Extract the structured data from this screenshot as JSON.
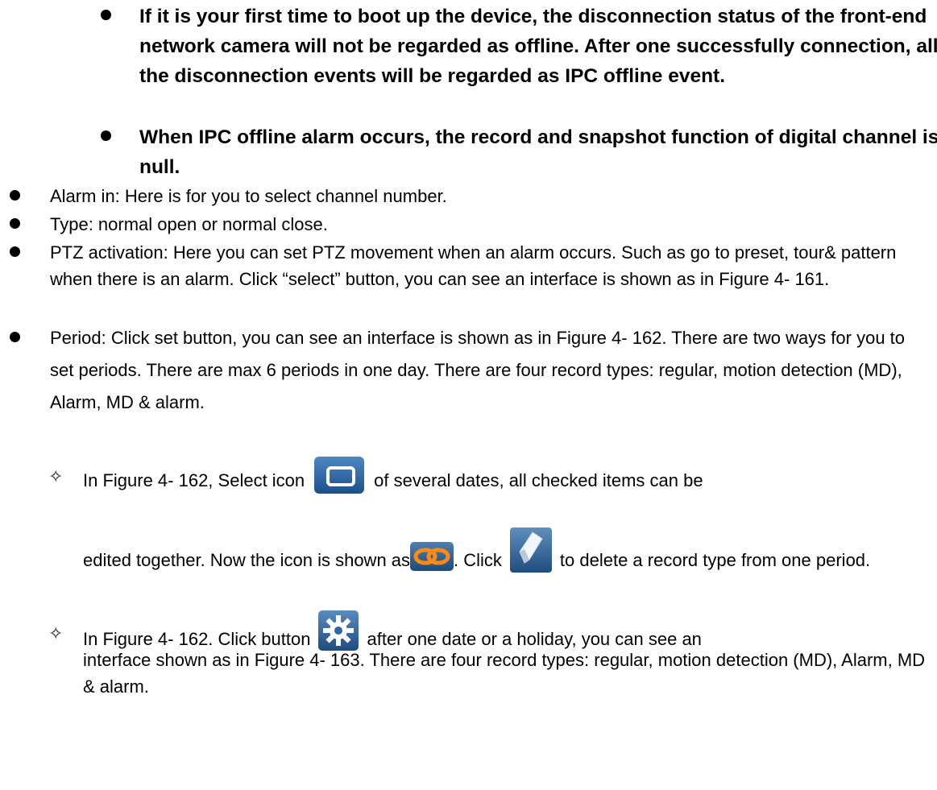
{
  "notes": [
    "If it is your first time to boot up the device, the disconnection status of the front-end network camera will not be regarded as offline. After one successfully connection, all the disconnection events will be regarded as IPC offline event.",
    "When IPC offline alarm occurs, the record and snapshot function of digital channel is null."
  ],
  "bullets": {
    "alarm_in": "Alarm in: Here is for you to select channel number.",
    "type": "Type: normal open or normal close.",
    "ptz": "PTZ activation: Here you can set PTZ movement when an alarm occurs. Such as go to preset, tour& pattern when there is an alarm. Click “select” button, you can see an interface is shown as in Figure 4- 161.",
    "period": "Period: Click set button, you can see an interface is shown as in Figure 4- 162. There are two ways for you to set periods. There are max 6 periods in one day. There are four record types: regular, motion detection (MD), Alarm, MD & alarm."
  },
  "sub_items": {
    "first": {
      "part1": "In Figure 4- 162, Select icon",
      "part2": "of several dates, all checked items can be edited together. Now the icon is shown as",
      "part3": ". Click",
      "part4": "to delete a record type from one period."
    },
    "second": {
      "part1": "In Figure 4- 162. Click button",
      "part2": "after one date or a holiday, you can see an interface shown as in Figure 4- 163. There are four record types: regular, motion detection (MD), Alarm, MD & alarm."
    }
  },
  "glyphs": {
    "diamond": "✧"
  },
  "icons": {
    "select_all": "square-select-icon",
    "link": "chain-link-icon",
    "eraser": "eraser-icon",
    "settings": "gear-icon"
  },
  "colors": {
    "icon_blue": "#2f66a8",
    "link_orange": "#e07a10"
  }
}
